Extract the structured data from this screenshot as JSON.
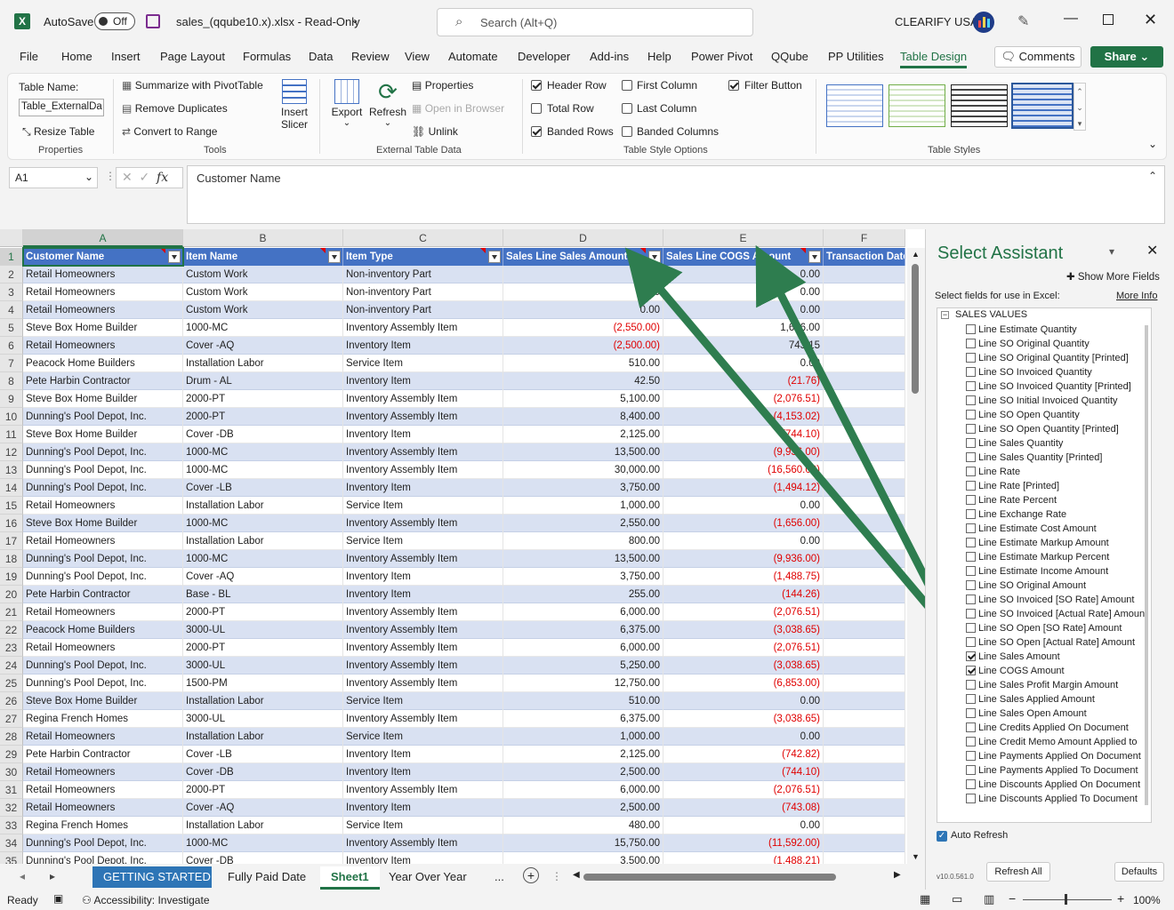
{
  "title_bar": {
    "autosave": "AutoSave",
    "autosave_state": "Off",
    "filename": "sales_(qqube10.x).xlsx  -  Read-Only",
    "search_placeholder": "Search (Alt+Q)",
    "company": "CLEARIFY USA"
  },
  "menu": [
    "File",
    "Home",
    "Insert",
    "Page Layout",
    "Formulas",
    "Data",
    "Review",
    "View",
    "Automate",
    "Developer",
    "Add-ins",
    "Help",
    "Power Pivot",
    "QQube",
    "PP Utilities",
    "Table Design"
  ],
  "menu_active": "Table Design",
  "comments_label": "Comments",
  "share_label": "Share",
  "ribbon": {
    "table_name_label": "Table Name:",
    "table_name_value": "Table_ExternalDa",
    "resize_table": "Resize Table",
    "properties_group": "Properties",
    "summarize": "Summarize with PivotTable",
    "remove_duplicates": "Remove Duplicates",
    "convert_to_range": "Convert to Range",
    "insert_slicer_1": "Insert",
    "insert_slicer_2": "Slicer",
    "tools_group": "Tools",
    "export": "Export",
    "refresh": "Refresh",
    "properties": "Properties",
    "open_in_browser": "Open in Browser",
    "unlink": "Unlink",
    "external_group": "External Table Data",
    "header_row": "Header Row",
    "total_row": "Total Row",
    "banded_rows": "Banded Rows",
    "first_column": "First Column",
    "last_column": "Last Column",
    "banded_columns": "Banded Columns",
    "filter_button": "Filter Button",
    "style_options_group": "Table Style Options",
    "table_styles_group": "Table Styles"
  },
  "formula_bar": {
    "name_box": "A1",
    "fx": "fx",
    "content": "Customer Name"
  },
  "columns": [
    "A",
    "B",
    "C",
    "D",
    "E",
    "F"
  ],
  "headers": [
    "Customer Name",
    "Item Name",
    "Item Type",
    "Sales Line Sales Amount",
    "Sales Line COGS Amount",
    "Transaction Date"
  ],
  "row_numbers": [
    "1",
    "2",
    "3",
    "4",
    "5",
    "6",
    "7",
    "8",
    "9",
    "10",
    "11",
    "12",
    "13",
    "14",
    "15",
    "16",
    "17",
    "18",
    "19",
    "20",
    "21",
    "22",
    "23",
    "24",
    "25",
    "26",
    "27",
    "28",
    "29",
    "30",
    "31",
    "32",
    "33",
    "34",
    "35"
  ],
  "rows": [
    [
      "Retail Homeowners",
      "Custom Work",
      "Non-inventory Part",
      "",
      "0.00"
    ],
    [
      "Retail Homeowners",
      "Custom Work",
      "Non-inventory Part",
      "0.00",
      "0.00"
    ],
    [
      "Retail Homeowners",
      "Custom Work",
      "Non-inventory Part",
      "0.00",
      "0.00"
    ],
    [
      "Steve Box Home Builder",
      "1000-MC",
      "Inventory Assembly Item",
      "(2,550.00)",
      "1,656.00"
    ],
    [
      "Retail Homeowners",
      "Cover -AQ",
      "Inventory Item",
      "(2,500.00)",
      "743.15"
    ],
    [
      "Peacock Home Builders",
      "Installation Labor",
      "Service Item",
      "510.00",
      "0.00"
    ],
    [
      "Pete Harbin Contractor",
      "Drum - AL",
      "Inventory Item",
      "42.50",
      "(21.76)"
    ],
    [
      "Steve Box Home Builder",
      "2000-PT",
      "Inventory Assembly Item",
      "5,100.00",
      "(2,076.51)"
    ],
    [
      "Dunning's Pool Depot, Inc.",
      "2000-PT",
      "Inventory Assembly Item",
      "8,400.00",
      "(4,153.02)"
    ],
    [
      "Steve Box Home Builder",
      "Cover -DB",
      "Inventory Item",
      "2,125.00",
      "(744.10)"
    ],
    [
      "Dunning's Pool Depot, Inc.",
      "1000-MC",
      "Inventory Assembly Item",
      "13,500.00",
      "(9,936.00)"
    ],
    [
      "Dunning's Pool Depot, Inc.",
      "1000-MC",
      "Inventory Assembly Item",
      "30,000.00",
      "(16,560.00)"
    ],
    [
      "Dunning's Pool Depot, Inc.",
      "Cover -LB",
      "Inventory Item",
      "3,750.00",
      "(1,494.12)"
    ],
    [
      "Retail Homeowners",
      "Installation Labor",
      "Service Item",
      "1,000.00",
      "0.00"
    ],
    [
      "Steve Box Home Builder",
      "1000-MC",
      "Inventory Assembly Item",
      "2,550.00",
      "(1,656.00)"
    ],
    [
      "Retail Homeowners",
      "Installation Labor",
      "Service Item",
      "800.00",
      "0.00"
    ],
    [
      "Dunning's Pool Depot, Inc.",
      "1000-MC",
      "Inventory Assembly Item",
      "13,500.00",
      "(9,936.00)"
    ],
    [
      "Dunning's Pool Depot, Inc.",
      "Cover -AQ",
      "Inventory Item",
      "3,750.00",
      "(1,488.75)"
    ],
    [
      "Pete Harbin Contractor",
      "Base - BL",
      "Inventory Item",
      "255.00",
      "(144.26)"
    ],
    [
      "Retail Homeowners",
      "2000-PT",
      "Inventory Assembly Item",
      "6,000.00",
      "(2,076.51)"
    ],
    [
      "Peacock Home Builders",
      "3000-UL",
      "Inventory Assembly Item",
      "6,375.00",
      "(3,038.65)"
    ],
    [
      "Retail Homeowners",
      "2000-PT",
      "Inventory Assembly Item",
      "6,000.00",
      "(2,076.51)"
    ],
    [
      "Dunning's Pool Depot, Inc.",
      "3000-UL",
      "Inventory Assembly Item",
      "5,250.00",
      "(3,038.65)"
    ],
    [
      "Dunning's Pool Depot, Inc.",
      "1500-PM",
      "Inventory Assembly Item",
      "12,750.00",
      "(6,853.00)"
    ],
    [
      "Steve Box Home Builder",
      "Installation Labor",
      "Service Item",
      "510.00",
      "0.00"
    ],
    [
      "Regina French Homes",
      "3000-UL",
      "Inventory Assembly Item",
      "6,375.00",
      "(3,038.65)"
    ],
    [
      "Retail Homeowners",
      "Installation Labor",
      "Service Item",
      "1,000.00",
      "0.00"
    ],
    [
      "Pete Harbin Contractor",
      "Cover -LB",
      "Inventory Item",
      "2,125.00",
      "(742.82)"
    ],
    [
      "Retail Homeowners",
      "Cover -DB",
      "Inventory Item",
      "2,500.00",
      "(744.10)"
    ],
    [
      "Retail Homeowners",
      "2000-PT",
      "Inventory Assembly Item",
      "6,000.00",
      "(2,076.51)"
    ],
    [
      "Retail Homeowners",
      "Cover -AQ",
      "Inventory Item",
      "2,500.00",
      "(743.08)"
    ],
    [
      "Regina French Homes",
      "Installation Labor",
      "Service Item",
      "480.00",
      "0.00"
    ],
    [
      "Dunning's Pool Depot, Inc.",
      "1000-MC",
      "Inventory Assembly Item",
      "15,750.00",
      "(11,592.00)"
    ],
    [
      "Dunning's Pool Depot, Inc.",
      "Cover -DB",
      "Inventory Item",
      "3,500.00",
      "(1,488.21)"
    ]
  ],
  "sheet_tabs": [
    "GETTING STARTED",
    "Fully Paid Date",
    "Sheet1",
    "Year Over Year"
  ],
  "active_sheet": "Sheet1",
  "tab_more": "...",
  "status": {
    "ready": "Ready",
    "accessibility": "Accessibility: Investigate",
    "zoom": "100%"
  },
  "pane": {
    "title": "Select Assistant",
    "show_more": "Show More Fields",
    "instruction": "Select fields for use in Excel:",
    "more_info": "More Info",
    "group": "SALES VALUES",
    "fields": [
      {
        "label": "Line Estimate Quantity",
        "checked": false
      },
      {
        "label": "Line SO Original Quantity",
        "checked": false
      },
      {
        "label": "Line SO Original Quantity [Printed]",
        "checked": false
      },
      {
        "label": "Line SO Invoiced Quantity",
        "checked": false
      },
      {
        "label": "Line SO Invoiced Quantity [Printed]",
        "checked": false
      },
      {
        "label": "Line SO Initial Invoiced Quantity",
        "checked": false
      },
      {
        "label": "Line SO Open Quantity",
        "checked": false
      },
      {
        "label": "Line SO Open Quantity [Printed]",
        "checked": false
      },
      {
        "label": "Line Sales Quantity",
        "checked": false
      },
      {
        "label": "Line Sales Quantity [Printed]",
        "checked": false
      },
      {
        "label": "Line Rate",
        "checked": false
      },
      {
        "label": "Line Rate [Printed]",
        "checked": false
      },
      {
        "label": "Line Rate Percent",
        "checked": false
      },
      {
        "label": "Line Exchange Rate",
        "checked": false
      },
      {
        "label": "Line Estimate Cost Amount",
        "checked": false
      },
      {
        "label": "Line Estimate Markup Amount",
        "checked": false
      },
      {
        "label": "Line Estimate Markup Percent",
        "checked": false
      },
      {
        "label": "Line Estimate Income Amount",
        "checked": false
      },
      {
        "label": "Line SO Original Amount",
        "checked": false
      },
      {
        "label": "Line SO Invoiced [SO Rate] Amount",
        "checked": false
      },
      {
        "label": "Line SO Invoiced [Actual Rate] Amount",
        "checked": false
      },
      {
        "label": "Line SO Open [SO Rate] Amount",
        "checked": false
      },
      {
        "label": "Line SO Open [Actual Rate] Amount",
        "checked": false
      },
      {
        "label": "Line Sales Amount",
        "checked": true
      },
      {
        "label": "Line COGS Amount",
        "checked": true
      },
      {
        "label": "Line Sales Profit Margin Amount",
        "checked": false
      },
      {
        "label": "Line Sales Applied Amount",
        "checked": false
      },
      {
        "label": "Line Sales Open Amount",
        "checked": false
      },
      {
        "label": "Line Credits Applied On Document",
        "checked": false
      },
      {
        "label": "Line Credit Memo Amount Applied to",
        "checked": false
      },
      {
        "label": "Line Payments Applied On Document",
        "checked": false
      },
      {
        "label": "Line Payments Applied To Document",
        "checked": false
      },
      {
        "label": "Line Discounts Applied On Document",
        "checked": false
      },
      {
        "label": "Line Discounts Applied To Document",
        "checked": false
      }
    ],
    "auto_refresh": "Auto Refresh",
    "version": "v10.0.561.0",
    "refresh_all": "Refresh All",
    "defaults": "Defaults"
  },
  "colors": {
    "header_blue": "#4472c4",
    "band_blue": "#d9e1f2",
    "excel_green": "#217346",
    "arrow_green": "#2e7d4f",
    "negative_red": "#e00000"
  }
}
